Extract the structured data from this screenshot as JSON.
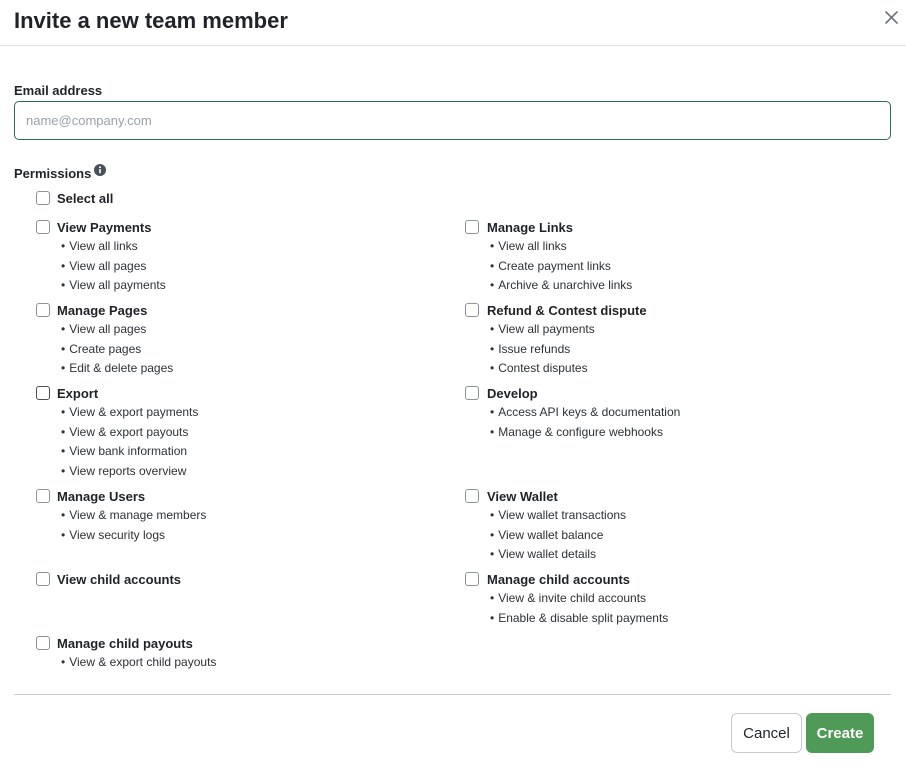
{
  "dialog": {
    "title": "Invite a new team member",
    "close_icon": "close-icon"
  },
  "email": {
    "label": "Email address",
    "placeholder": "name@company.com",
    "value": ""
  },
  "permissions": {
    "label": "Permissions",
    "info_icon": "info-icon",
    "select_all": "Select all",
    "groups": [
      {
        "label": "View Payments",
        "items": [
          "View all links",
          "View all pages",
          "View all payments"
        ]
      },
      {
        "label": "Manage Links",
        "items": [
          "View all links",
          "Create payment links",
          "Archive & unarchive links"
        ]
      },
      {
        "label": "Manage Pages",
        "items": [
          "View all pages",
          "Create pages",
          "Edit & delete pages"
        ]
      },
      {
        "label": "Refund & Contest dispute",
        "items": [
          "View all payments",
          "Issue refunds",
          "Contest disputes"
        ]
      },
      {
        "label": "Export",
        "items": [
          "View & export payments",
          "View & export payouts",
          "View bank information",
          "View reports overview"
        ]
      },
      {
        "label": "Develop",
        "items": [
          "Access API keys & documentation",
          "Manage & configure webhooks"
        ]
      },
      {
        "label": "Manage Users",
        "items": [
          "View & manage members",
          "View security logs"
        ]
      },
      {
        "label": "View Wallet",
        "items": [
          "View wallet transactions",
          "View wallet balance",
          "View wallet details"
        ]
      },
      {
        "label": "View child accounts",
        "items": []
      },
      {
        "label": "Manage child accounts",
        "items": [
          "View & invite child accounts",
          "Enable & disable split payments"
        ]
      },
      {
        "label": "Manage child payouts",
        "items": [
          "View & export child payouts"
        ]
      }
    ]
  },
  "footer": {
    "cancel_label": "Cancel",
    "create_label": "Create"
  },
  "colors": {
    "primary_button": "#4f9a57",
    "input_focus_border": "#2f6b4f"
  }
}
